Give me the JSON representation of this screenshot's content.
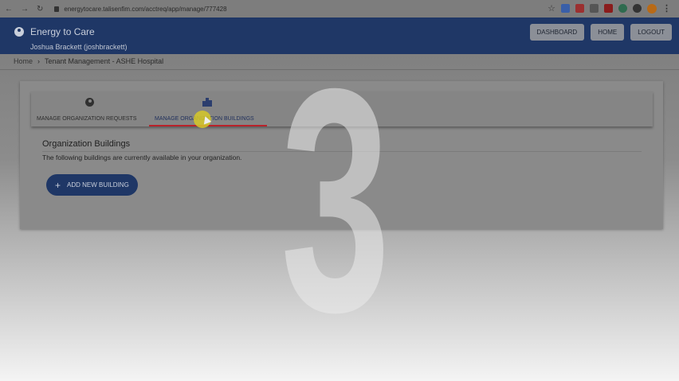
{
  "browser": {
    "url": "energytocare.talisenfim.com/acctreq/app/manage/777428"
  },
  "app": {
    "title": "Energy to Care",
    "user": "Joshua Brackett (joshbrackett)",
    "buttons": [
      "DASHBOARD",
      "HOME",
      "LOGOUT"
    ],
    "brand_color": "#1f3766"
  },
  "breadcrumb": {
    "home": "Home",
    "separator": "›",
    "current": "Tenant Management - ASHE Hospital"
  },
  "tabs": [
    {
      "label": "MANAGE ORGANIZATION REQUESTS",
      "icon": "person-icon",
      "active": false
    },
    {
      "label": "MANAGE ORGANIZATION BUILDINGS",
      "icon": "building-icon",
      "active": true
    }
  ],
  "section": {
    "title": "Organization Buildings",
    "description": "The following buildings are currently available in your organization.",
    "add_button": "ADD NEW BUILDING"
  },
  "overlay": {
    "step_number": "3"
  },
  "colors": {
    "active_tab_underline": "#b8232b",
    "cursor_highlight": "#d6c828"
  }
}
